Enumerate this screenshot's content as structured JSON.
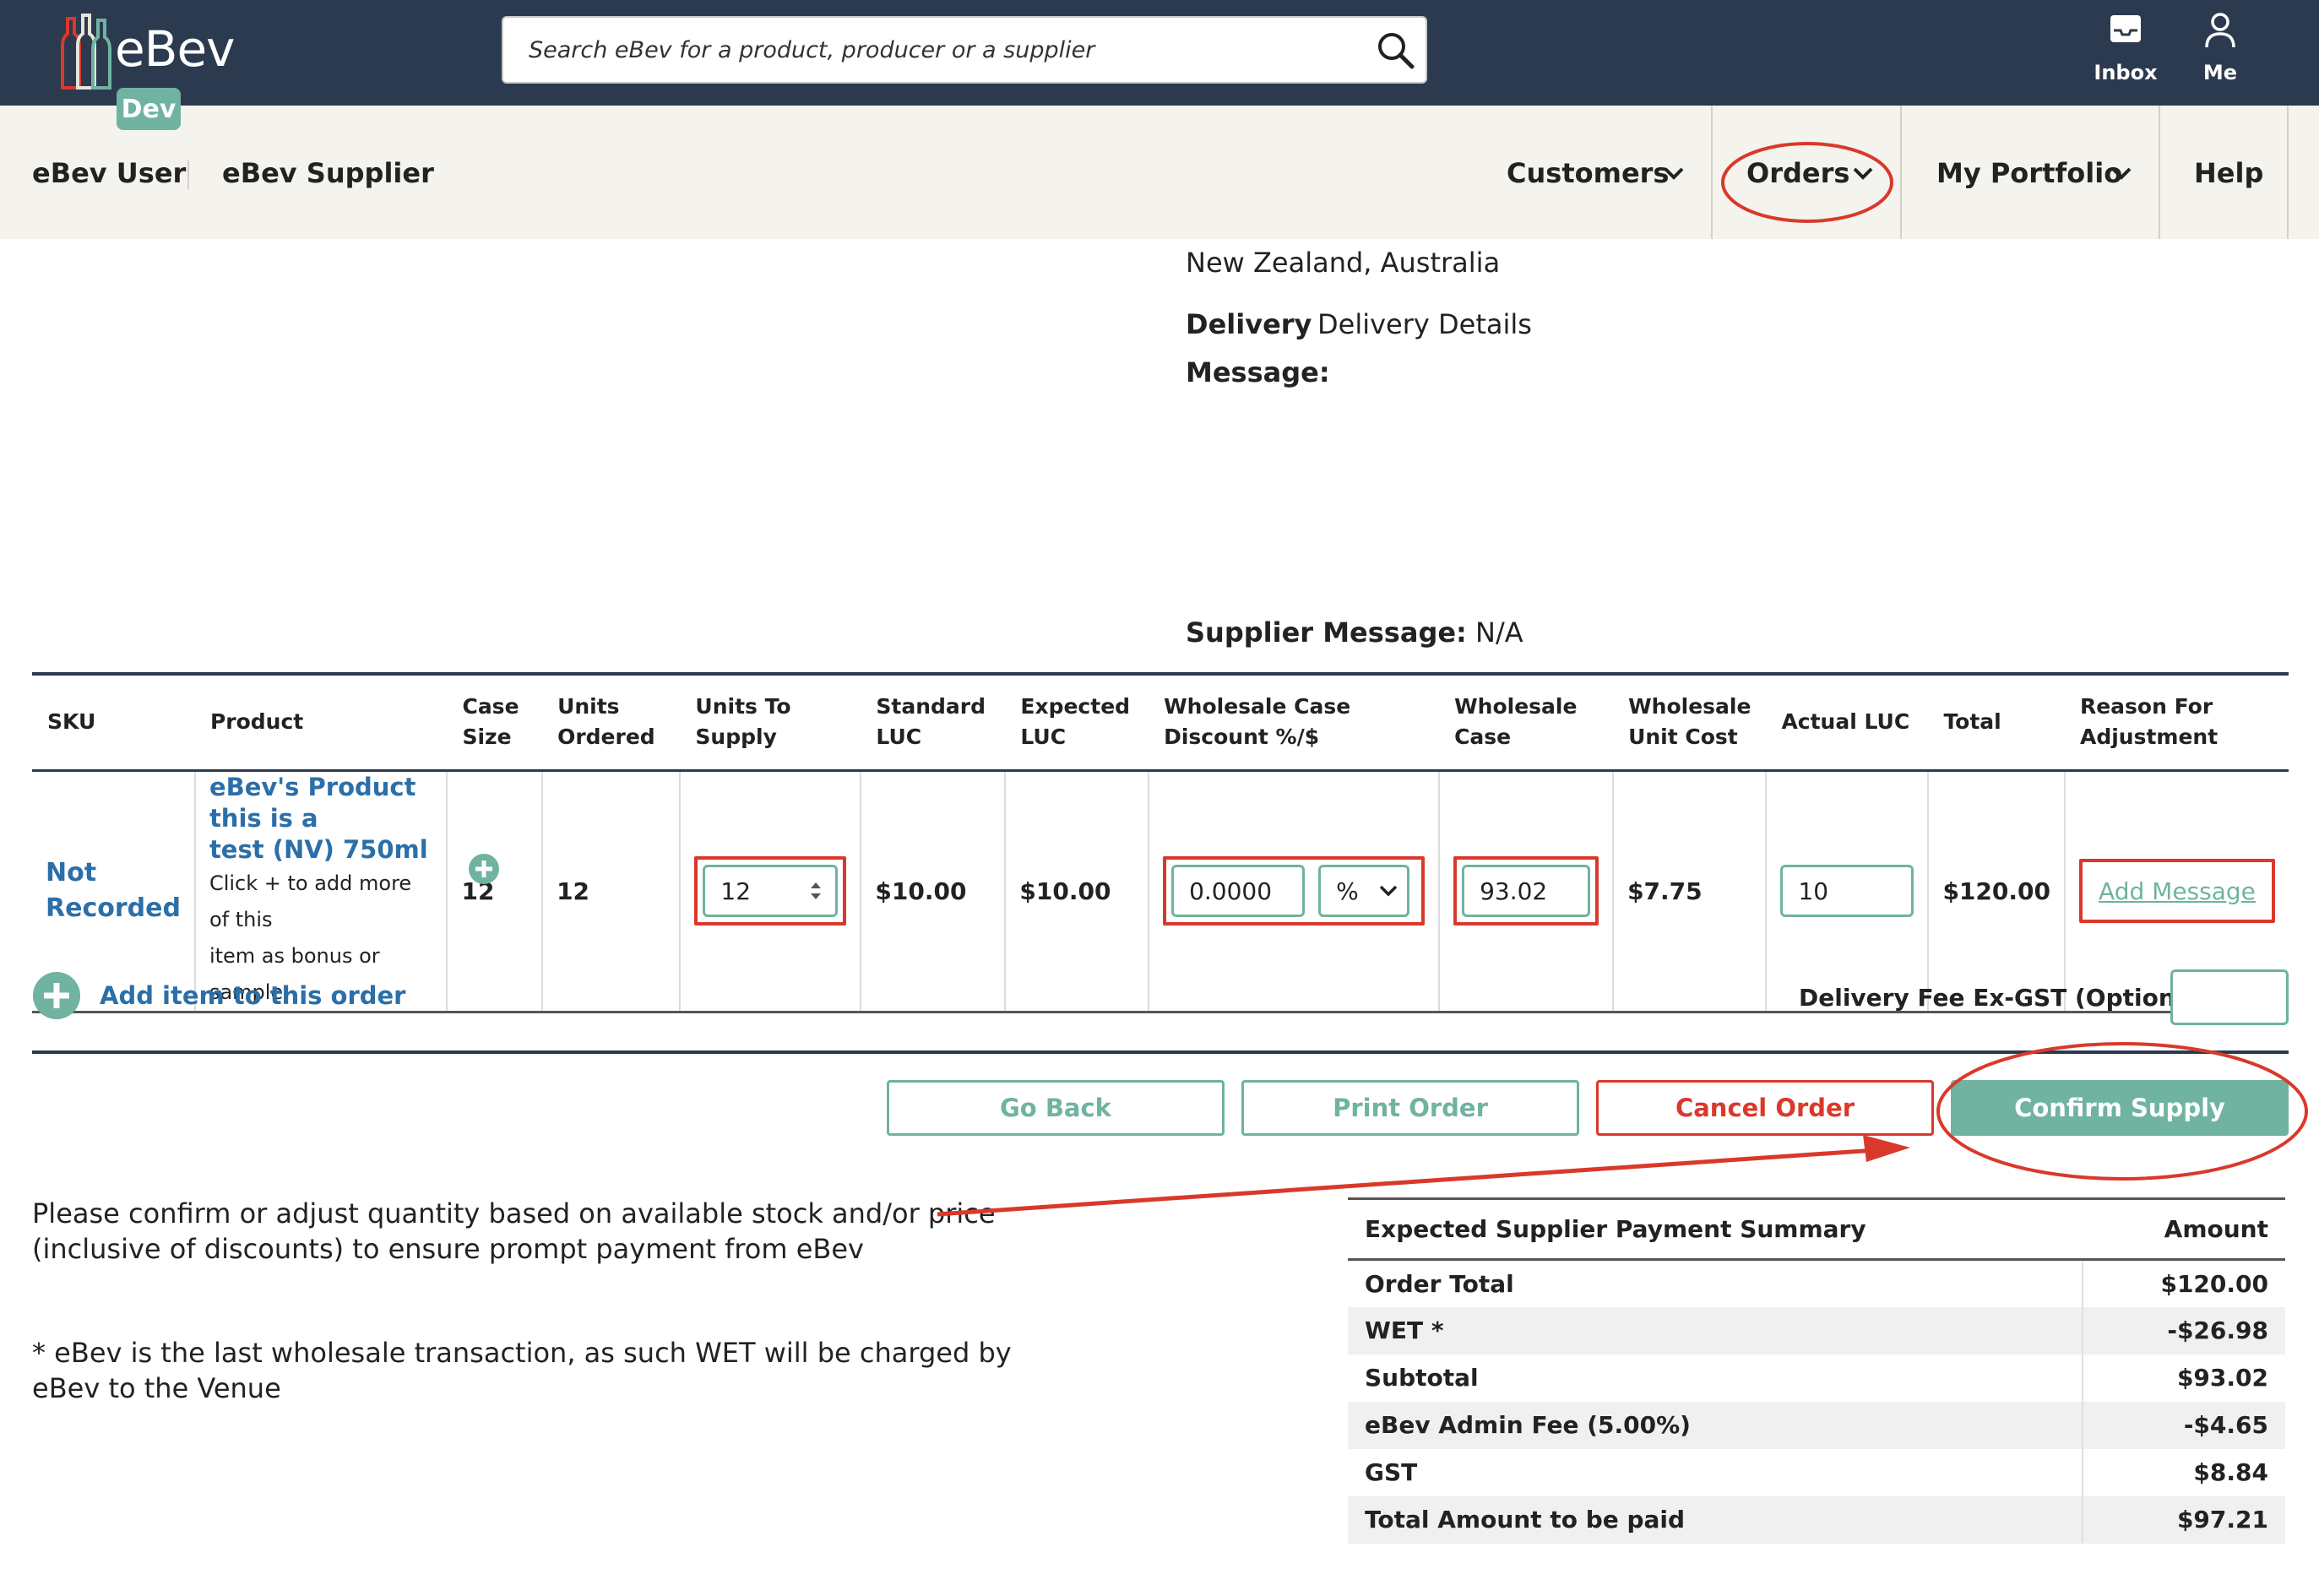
{
  "app": {
    "logo": "eBev",
    "env_badge": "Dev",
    "search_placeholder": "Search eBev for a product, producer or a supplier",
    "inbox_label": "Inbox",
    "me_label": "Me"
  },
  "subnav": {
    "user": "eBev User",
    "company": "eBev Supplier",
    "customers": "Customers",
    "orders": "Orders",
    "portfolio": "My Portfolio",
    "help": "Help"
  },
  "order_info": {
    "region": "New Zealand, Australia",
    "delivery_label": "Delivery",
    "delivery_value": "Delivery Details",
    "message_label": "Message:",
    "supplier_message_label": "Supplier Message:",
    "supplier_message_value": "N/A"
  },
  "table": {
    "headers": {
      "sku": "SKU",
      "product": "Product",
      "case_size_1": "Case",
      "case_size_2": "Size",
      "units_ordered_1": "Units",
      "units_ordered_2": "Ordered",
      "units_supply_1": "Units To",
      "units_supply_2": "Supply",
      "standard_luc_1": "Standard",
      "standard_luc_2": "LUC",
      "expected_luc_1": "Expected",
      "expected_luc_2": "LUC",
      "discount_1": "Wholesale Case",
      "discount_2": "Discount %/$",
      "wholesale_case_1": "Wholesale",
      "wholesale_case_2": "Case",
      "unit_cost_1": "Wholesale",
      "unit_cost_2": "Unit Cost",
      "actual_luc": "Actual LUC",
      "total": "Total",
      "reason_1": "Reason For",
      "reason_2": "Adjustment"
    },
    "row": {
      "sku_1": "Not",
      "sku_2": "Recorded",
      "product_name_1": "eBev's Product this is a",
      "product_name_2": "test (NV) 750ml",
      "product_note_1": "Click + to add more of this",
      "product_note_2": "item as bonus or sample",
      "case_size": "12",
      "units_ordered": "12",
      "units_to_supply": "12",
      "standard_luc": "$10.00",
      "expected_luc": "$10.00",
      "discount": "0.0000",
      "discount_type": "%",
      "wholesale_case": "93.02",
      "wholesale_unit_cost": "$7.75",
      "actual_luc": "10",
      "total": "$120.00",
      "reason": "Add Message"
    }
  },
  "add_item": "Add item to this order",
  "delivery_fee_label": "Delivery Fee Ex-GST (Optional)",
  "buttons": {
    "go_back": "Go Back",
    "print": "Print Order",
    "cancel": "Cancel Order",
    "confirm": "Confirm Supply"
  },
  "notes": {
    "confirm_note_1": "Please confirm or adjust quantity based on available stock and/or price",
    "confirm_note_2": "(inclusive of discounts) to ensure prompt payment from eBev",
    "wet_note_1": "* eBev is the last wholesale transaction, as such WET will be charged by",
    "wet_note_2": "eBev to the Venue"
  },
  "summary": {
    "title": "Expected Supplier Payment Summary",
    "amount_header": "Amount",
    "rows": [
      {
        "label": "Order Total",
        "amount": "$120.00"
      },
      {
        "label": "WET *",
        "amount": "-$26.98"
      },
      {
        "label": "Subtotal",
        "amount": "$93.02"
      },
      {
        "label": "eBev Admin Fee (5.00%)",
        "amount": "-$4.65"
      },
      {
        "label": "GST",
        "amount": "$8.84"
      },
      {
        "label": "Total Amount to be paid",
        "amount": "$97.21"
      }
    ]
  },
  "colors": {
    "header_bg": "#2b3a4e",
    "accent_green": "#6fb3a0",
    "link_blue": "#2c6fa8",
    "danger_red": "#d9392b",
    "subnav_bg": "#f5f3ee"
  },
  "icons": [
    "bottles-logo-icon",
    "search-icon",
    "inbox-icon",
    "user-icon",
    "chevron-down-icon",
    "plus-circle-icon",
    "spinner-arrows-icon"
  ]
}
